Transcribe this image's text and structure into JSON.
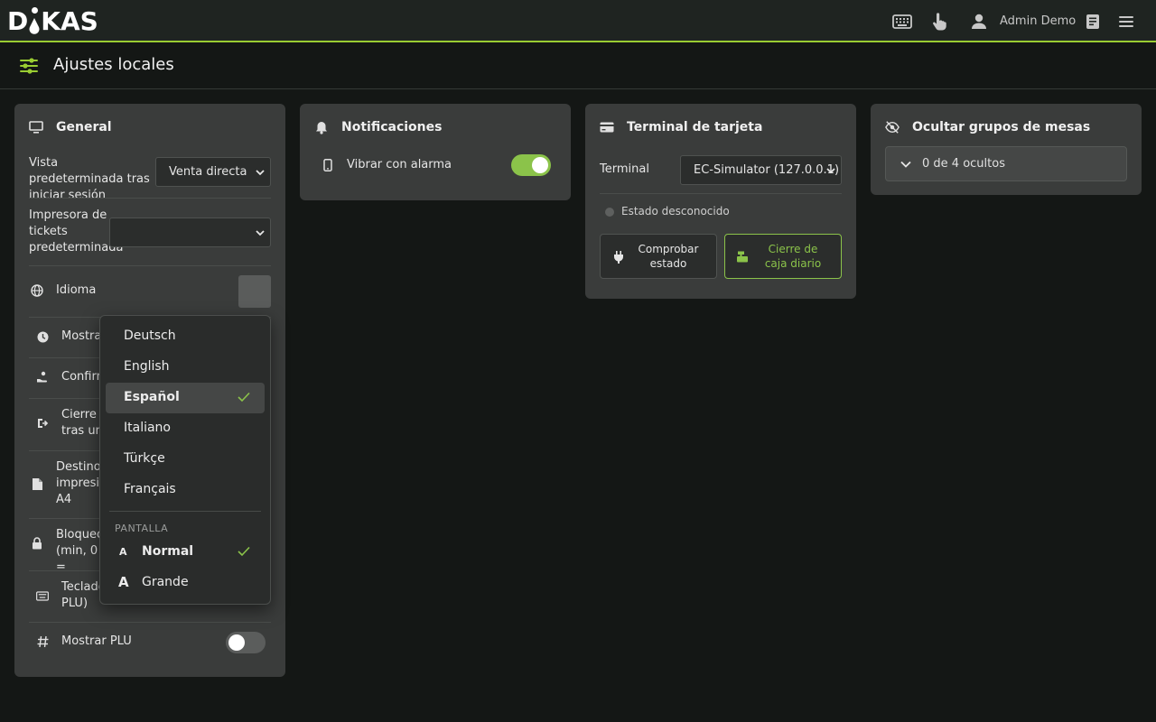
{
  "brand": {
    "logo_text_left": "D",
    "logo_text_right": "KAS",
    "accent": "#9acd32"
  },
  "topbar": {
    "icons": [
      "keyboard-icon",
      "touch-icon",
      "user-icon",
      "book-icon",
      "menu-icon"
    ],
    "user_name": "Admin Demo"
  },
  "page": {
    "title": "Ajustes locales",
    "icon": "sliders-icon"
  },
  "general": {
    "title": "General",
    "default_view_label": "Vista predeterminada tras iniciar sesión",
    "default_view_value": "Venta directa",
    "printer_label": "Impresora de tickets predeterminada",
    "printer_value": "",
    "language_label": "Idioma",
    "rows": [
      {
        "label": "Mostra",
        "icon": "clock-icon"
      },
      {
        "label": "Confirm",
        "icon": "hand-coin-icon"
      },
      {
        "label": "Cierre d tras una",
        "icon": "logout-icon"
      },
      {
        "label": "Destino impresió A4",
        "icon": "pdf-file-icon"
      },
      {
        "label": "Bloqueo (min, 0 =",
        "icon": "lock-icon"
      },
      {
        "label": "Teclado PLU)",
        "icon": "keyboard-icon"
      }
    ],
    "show_plu_label": "Mostrar PLU",
    "show_plu_on": false
  },
  "language_menu": {
    "languages": [
      "Deutsch",
      "English",
      "Español",
      "Italiano",
      "Türkçe",
      "Français"
    ],
    "selected_language": "Español",
    "section_label": "PANTALLA",
    "display_sizes": [
      {
        "label": "Normal",
        "selected": true
      },
      {
        "label": "Grande",
        "selected": false
      }
    ]
  },
  "notifications": {
    "title": "Notificaciones",
    "vibrate_label": "Vibrar con alarma",
    "vibrate_on": true
  },
  "card_terminal": {
    "title": "Terminal de tarjeta",
    "terminal_label": "Terminal",
    "terminal_value": "EC-Simulator (127.0.0.1)",
    "status_text": "Estado desconocido",
    "check_button": "Comprobar estado",
    "close_button": "Cierre de caja diario"
  },
  "hide_tables": {
    "title": "Ocultar grupos de mesas",
    "summary": "0 de 4 ocultos"
  }
}
